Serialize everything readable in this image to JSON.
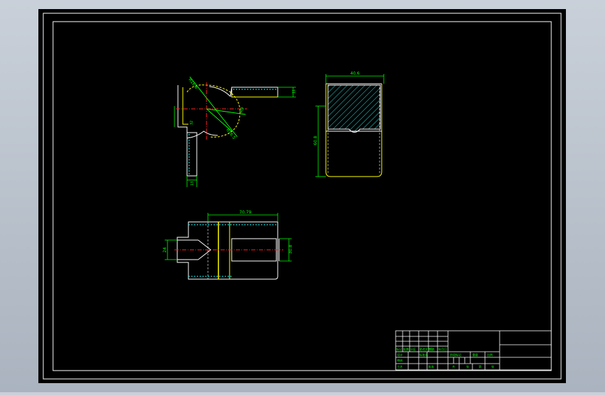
{
  "window": {
    "background": "#b3bcc8",
    "sheet_color": "#000000"
  },
  "colors": {
    "outline": "#ffffff",
    "part": "#ffff00",
    "dimension": "#00ff00",
    "center": "#ff2020",
    "hatch": "#00ffff",
    "title_text": "#00ff00"
  },
  "views": {
    "top": {
      "dim_r_upper": "R16.8",
      "dim_r_lower": "R16.5",
      "dim_r_right": "R9",
      "dim_tab_h": "11",
      "dim_left_h": "32",
      "dim_bottom_w": "13"
    },
    "side": {
      "dim_width": "40.6",
      "dim_height": "60.8"
    },
    "front": {
      "dim_width": "70.79",
      "dim_left_h": "24",
      "dim_right_h": "30.8"
    }
  },
  "title_block": {
    "row_labels": [
      "标记",
      "处数",
      "分区",
      "更改文件号",
      "签名",
      "年月日"
    ],
    "cells": [
      "设计",
      "标准化",
      "阶段标记",
      "重量",
      "比例",
      "审核",
      "工艺",
      "批准",
      "共",
      "张",
      "第",
      "张"
    ]
  }
}
